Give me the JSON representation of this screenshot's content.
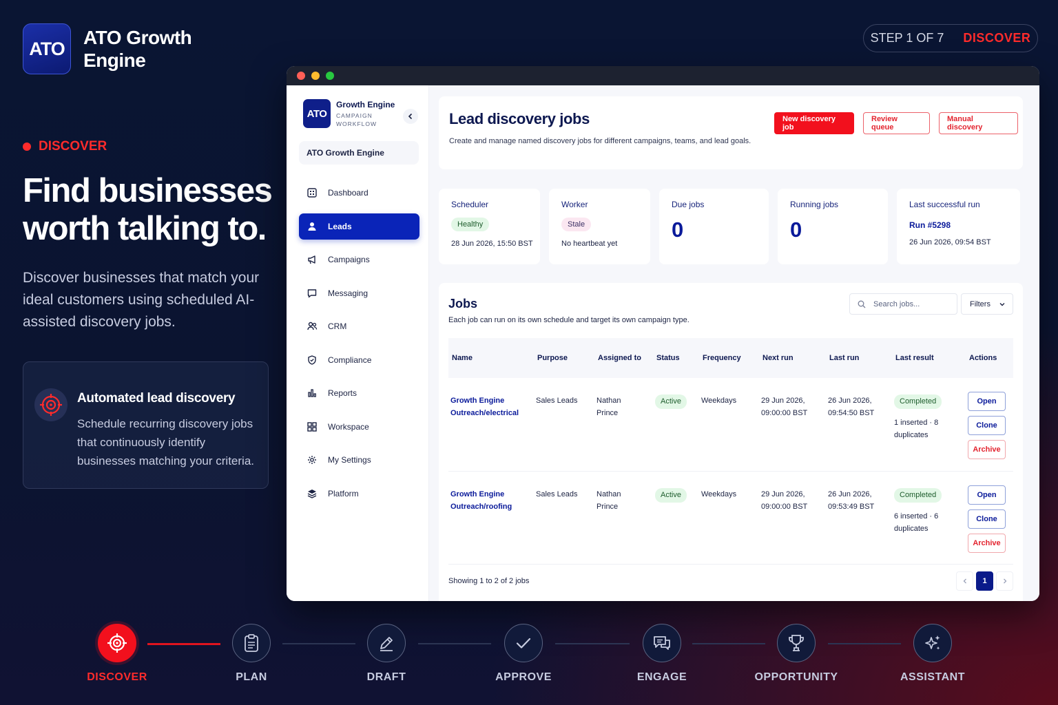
{
  "brand": {
    "logo": "ATO",
    "name": "ATO Growth Engine"
  },
  "step": {
    "count": "STEP 1 OF 7",
    "name": "DISCOVER"
  },
  "hero": {
    "tag": "DISCOVER",
    "title": "Find businesses worth talking to.",
    "subtitle": "Discover businesses that match your ideal customers using scheduled AI-assisted discovery jobs.",
    "feature": {
      "icon": "target-icon",
      "title": "Automated lead discovery",
      "text": "Schedule recurring discovery jobs that continuously identify businesses matching your criteria."
    }
  },
  "app": {
    "sidebar": {
      "logo": "ATO",
      "title": "Growth Engine",
      "subtitle": "CAMPAIGN WORKFLOW",
      "workspace": "ATO Growth Engine",
      "items": [
        {
          "label": "Dashboard",
          "icon": "dashboard-icon",
          "active": false
        },
        {
          "label": "Leads",
          "icon": "user-icon",
          "active": true
        },
        {
          "label": "Campaigns",
          "icon": "megaphone-icon",
          "active": false
        },
        {
          "label": "Messaging",
          "icon": "message-icon",
          "active": false
        },
        {
          "label": "CRM",
          "icon": "users-icon",
          "active": false
        },
        {
          "label": "Compliance",
          "icon": "shield-icon",
          "active": false
        },
        {
          "label": "Reports",
          "icon": "bar-chart-icon",
          "active": false
        },
        {
          "label": "Workspace",
          "icon": "grid-icon",
          "active": false
        },
        {
          "label": "My Settings",
          "icon": "gear-icon",
          "active": false
        },
        {
          "label": "Platform",
          "icon": "layers-icon",
          "active": false
        }
      ]
    },
    "header": {
      "title": "Lead discovery jobs",
      "subtitle": "Create and manage named discovery jobs for different campaigns, teams, and lead goals.",
      "buttons": {
        "new": "New discovery job",
        "review": "Review queue",
        "manual": "Manual discovery"
      }
    },
    "stats": {
      "scheduler": {
        "label": "Scheduler",
        "status": "Healthy",
        "time": "28 Jun 2026, 15:50 BST"
      },
      "worker": {
        "label": "Worker",
        "status": "Stale",
        "note": "No heartbeat yet"
      },
      "due": {
        "label": "Due jobs",
        "value": "0"
      },
      "running": {
        "label": "Running jobs",
        "value": "0"
      },
      "last": {
        "label": "Last successful run",
        "run": "Run #5298",
        "time": "26 Jun 2026, 09:54 BST"
      }
    },
    "jobs": {
      "title": "Jobs",
      "subtitle": "Each job can run on its own schedule and target its own campaign type.",
      "search_placeholder": "Search jobs...",
      "filters_label": "Filters",
      "columns": [
        "Name",
        "Purpose",
        "Assigned to",
        "Status",
        "Frequency",
        "Next run",
        "Last run",
        "Last result",
        "Actions"
      ],
      "rows": [
        {
          "name": "Growth Engine Outreach/electrical",
          "purpose": "Sales Leads",
          "assigned": "Nathan Prince",
          "status": "Active",
          "frequency": "Weekdays",
          "next_run": "29 Jun 2026, 09:00:00 BST",
          "last_run": "26 Jun 2026, 09:54:50 BST",
          "result": "Completed",
          "result_note": "1 inserted · 8 duplicates"
        },
        {
          "name": "Growth Engine Outreach/roofing",
          "purpose": "Sales Leads",
          "assigned": "Nathan Prince",
          "status": "Active",
          "frequency": "Weekdays",
          "next_run": "29 Jun 2026, 09:00:00 BST",
          "last_run": "26 Jun 2026, 09:53:49 BST",
          "result": "Completed",
          "result_note": "6 inserted · 6 duplicates"
        }
      ],
      "actions": {
        "open": "Open",
        "clone": "Clone",
        "archive": "Archive"
      },
      "footer": "Showing 1 to 2 of 2 jobs",
      "page": "1"
    }
  },
  "stepper": [
    {
      "label": "DISCOVER",
      "icon": "target-icon",
      "active": true
    },
    {
      "label": "PLAN",
      "icon": "clipboard-icon",
      "active": false
    },
    {
      "label": "DRAFT",
      "icon": "pencil-icon",
      "active": false
    },
    {
      "label": "APPROVE",
      "icon": "check-icon",
      "active": false
    },
    {
      "label": "ENGAGE",
      "icon": "chat-icon",
      "active": false
    },
    {
      "label": "OPPORTUNITY",
      "icon": "trophy-icon",
      "active": false
    },
    {
      "label": "ASSISTANT",
      "icon": "sparkle-icon",
      "active": false
    }
  ],
  "colors": {
    "accent_red": "#f2101d",
    "primary_blue": "#0a24b8",
    "background": "#0a1533"
  }
}
